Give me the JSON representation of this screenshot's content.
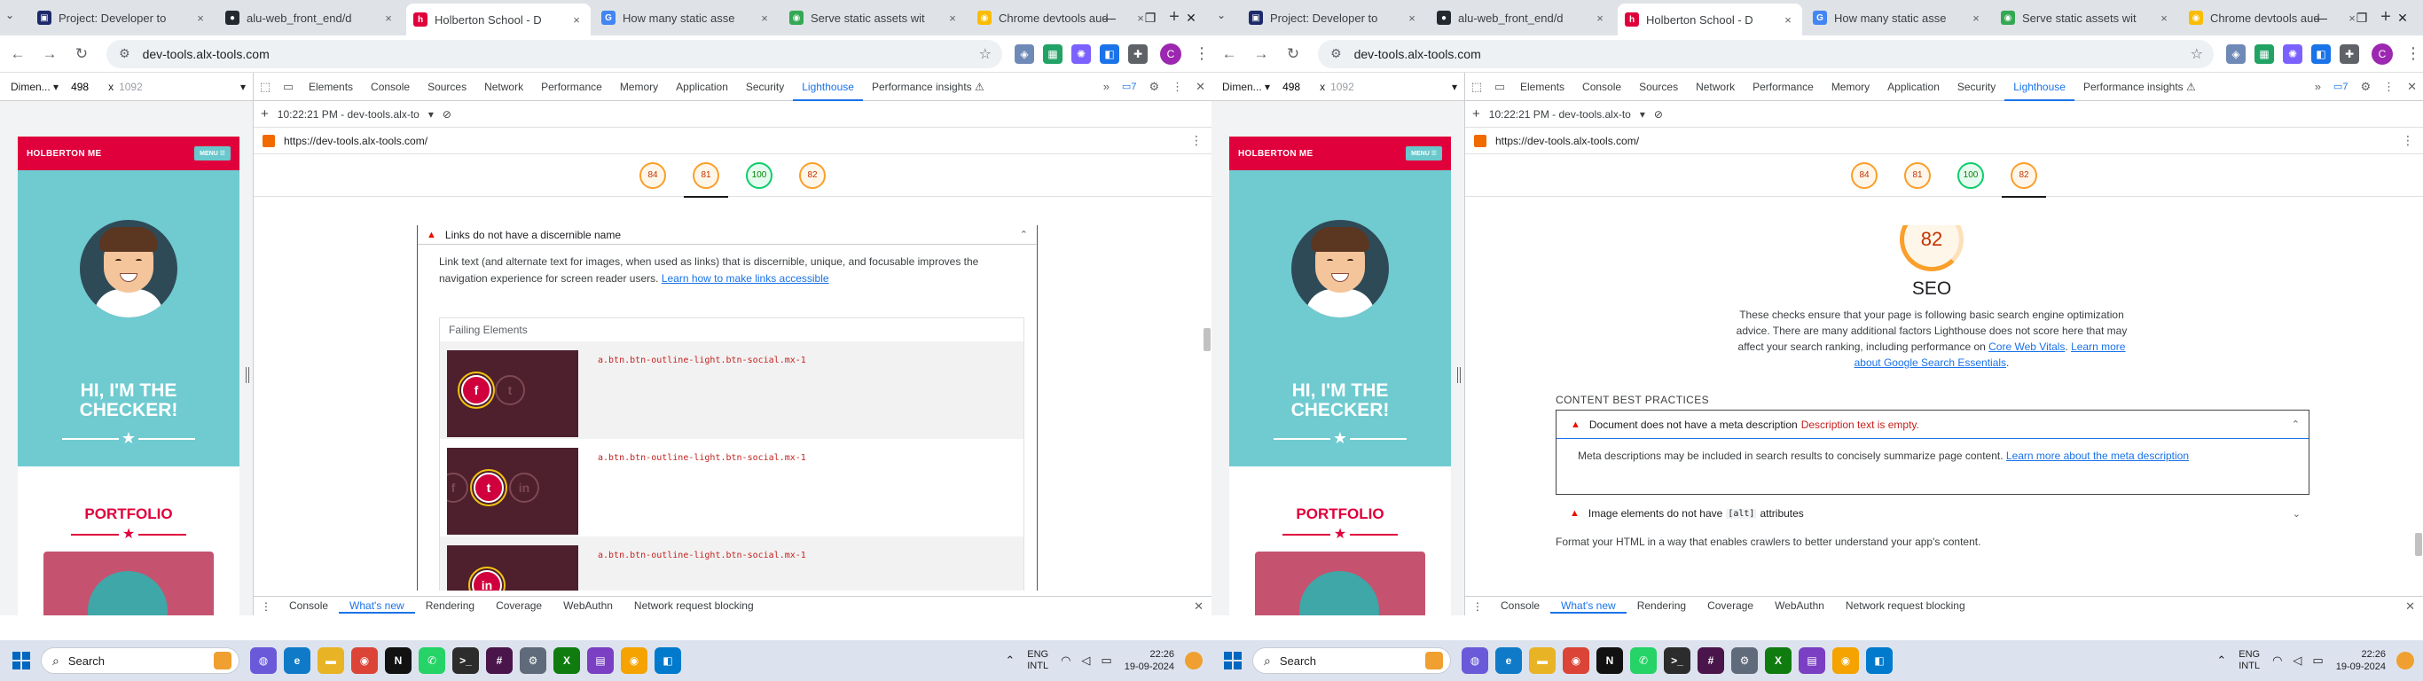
{
  "browser": {
    "tabs_dropdown": "⌄",
    "tabs": [
      {
        "title": "Project: Developer to",
        "icon": "alx-icon",
        "color": "#1c2a6b",
        "glyph": "▣"
      },
      {
        "title": "alu-web_front_end/d",
        "icon": "github-icon",
        "color": "#24292f",
        "glyph": "●"
      },
      {
        "title": "Holberton School - D",
        "icon": "holberton-icon",
        "color": "#e0003c",
        "glyph": "h"
      },
      {
        "title": "How many static asse",
        "icon": "google-icon",
        "color": "#4285f4",
        "glyph": "G"
      },
      {
        "title": "Serve static assets wit",
        "icon": "chrome-icon",
        "color": "#34a853",
        "glyph": "◉"
      },
      {
        "title": "Chrome devtools aud",
        "icon": "chrome-icon",
        "color": "#fbbc05",
        "glyph": "◉"
      }
    ],
    "active_tab": 2,
    "tab_close": "×",
    "new_tab": "+",
    "window": {
      "minimize": "—",
      "restore": "❐",
      "close": "✕"
    },
    "url": "dev-tools.alx-tools.com",
    "nav": {
      "back": "←",
      "forward": "→",
      "reload": "↻",
      "tune": "⚙",
      "bookmark": "☆"
    },
    "extensions": [
      {
        "name": "shield-extension-icon",
        "color": "#6f8ab7",
        "glyph": "◈"
      },
      {
        "name": "green-extension-icon",
        "color": "#21a366",
        "glyph": "▦"
      },
      {
        "name": "purple-extension-icon",
        "color": "#7b61ff",
        "glyph": "✺"
      },
      {
        "name": "blue-extension-icon",
        "color": "#1a73e8",
        "glyph": "◧"
      },
      {
        "name": "puzzle-extension-icon",
        "color": "#5f6368",
        "glyph": "✚"
      }
    ],
    "profile": "C",
    "menu": "⋮"
  },
  "device_toolbar": {
    "dimensions_label": "Dimen...",
    "width": "498",
    "times": "x",
    "height": "1092",
    "dropdown": "▾"
  },
  "preview": {
    "logo": "HOLBERTON ME",
    "menu_button": "MENU ☰",
    "hero_title_line1": "HI, I'M THE",
    "hero_title_line2": "CHECKER!",
    "star": "★",
    "portfolio_title": "PORTFOLIO"
  },
  "devtools": {
    "icons": {
      "inspect": "⬚",
      "device": "▭",
      "more": "»",
      "settings": "⚙",
      "kebab": "⋮",
      "close": "✕"
    },
    "tabs": [
      "Elements",
      "Console",
      "Sources",
      "Network",
      "Performance",
      "Memory",
      "Application",
      "Security",
      "Lighthouse",
      "Performance insights ⚠"
    ],
    "active_tab": 8,
    "issues_badge": "▭7",
    "lighthouse_bar": {
      "add": "+",
      "time": "10:22:21 PM - dev-tools.alx-to",
      "dropdown": "▾",
      "clear": "⊘"
    },
    "report_url": "https://dev-tools.alx-tools.com/",
    "url_menu": "⋮",
    "scores": [
      {
        "value": "84",
        "level": "orange"
      },
      {
        "value": "81",
        "level": "orange"
      },
      {
        "value": "100",
        "level": "green"
      },
      {
        "value": "82",
        "level": "orange"
      }
    ],
    "drawer": {
      "menu": "⋮",
      "tabs": [
        "Console",
        "What's new",
        "Rendering",
        "Coverage",
        "WebAuthn",
        "Network request blocking"
      ],
      "active_tab": 1,
      "close": "✕"
    }
  },
  "left_report": {
    "selected_score": 1,
    "audit_title": "Links do not have a discernible name",
    "warn_icon": "▲",
    "caret": "⌃",
    "audit_desc": "Link text (and alternate text for images, when used as links) that is discernible, unique, and focusable improves the navigation experience for screen reader users.",
    "audit_link": "Learn how to make links accessible",
    "failing_title": "Failing Elements",
    "failing_rows": [
      {
        "selector": "a.btn.btn-outline-light.btn-social.mx-1",
        "icons": [
          "f",
          "t"
        ],
        "hot": 0
      },
      {
        "selector": "a.btn.btn-outline-light.btn-social.mx-1",
        "icons": [
          "f",
          "t",
          "in"
        ],
        "hot": 1
      },
      {
        "selector": "a.btn.btn-outline-light.btn-social.mx-1",
        "icons": [
          "in"
        ],
        "hot": 0
      }
    ],
    "scroll_fraction": 0.3
  },
  "right_report": {
    "selected_score": 3,
    "big_score": "82",
    "category_title": "SEO",
    "category_desc": "These checks ensure that your page is following basic search engine optimization advice. There are many additional factors Lighthouse does not score here that may affect your search ranking, including performance on",
    "link_cwv": "Core Web Vitals",
    "link_essentials": "Learn more about Google Search Essentials",
    "section_title": "CONTENT BEST PRACTICES",
    "meta_audit_title": "Document does not have a meta description",
    "meta_audit_error": "Description text is empty.",
    "meta_audit_desc": "Meta descriptions may be included in search results to concisely summarize page content.",
    "meta_audit_link": "Learn more about the meta description",
    "image_audit_prefix": "Image elements do not have",
    "image_audit_code": "[alt]",
    "image_audit_suffix": "attributes",
    "group_desc": "Format your HTML in a way that enables crawlers to better understand your app's content.",
    "caret_up": "⌃",
    "caret_down": "⌄",
    "scroll_fraction": 0.9
  },
  "taskbar": {
    "search_placeholder": "Search",
    "search_icon": "⌕",
    "apps": [
      {
        "name": "copilot-icon",
        "color": "#6a5ad9",
        "glyph": "◍"
      },
      {
        "name": "edge-icon",
        "color": "#0f7bc8",
        "glyph": "e"
      },
      {
        "name": "file-explorer-icon",
        "color": "#e8b325",
        "glyph": "▬"
      },
      {
        "name": "chrome-taskbar-icon",
        "color": "#db4437",
        "glyph": "◉"
      },
      {
        "name": "netflix-icon",
        "color": "#111111",
        "glyph": "N"
      },
      {
        "name": "whatsapp-icon",
        "color": "#25d366",
        "glyph": "✆"
      },
      {
        "name": "terminal-icon",
        "color": "#2c2c2c",
        "glyph": ">_"
      },
      {
        "name": "slack-icon",
        "color": "#4a154b",
        "glyph": "#"
      },
      {
        "name": "settings-icon",
        "color": "#5f6b7a",
        "glyph": "⚙"
      },
      {
        "name": "xbox-icon",
        "color": "#107c10",
        "glyph": "X"
      },
      {
        "name": "store-icon",
        "color": "#7a3fc2",
        "glyph": "▤"
      },
      {
        "name": "chrome-canary-icon",
        "color": "#f4a300",
        "glyph": "◉"
      },
      {
        "name": "vscode-icon",
        "color": "#007acc",
        "glyph": "◧"
      }
    ],
    "tray_up": "⌃",
    "lang1": "ENG",
    "lang2": "INTL",
    "wifi": "◠",
    "volume": "◁",
    "battery": "▭",
    "time": "22:26",
    "date": "19-09-2024"
  }
}
